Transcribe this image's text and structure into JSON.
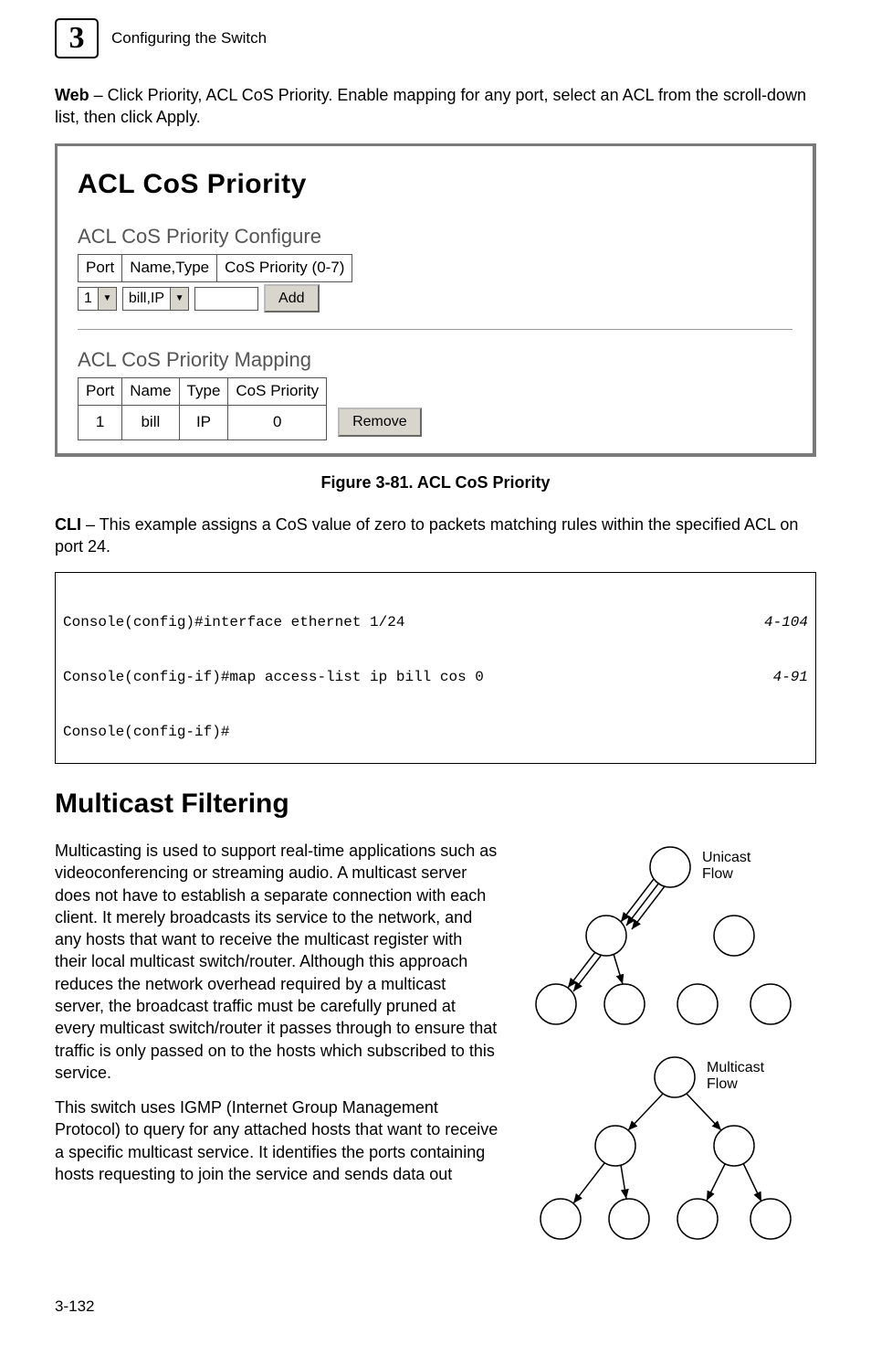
{
  "header": {
    "chapter_num": "3",
    "chapter_title": "Configuring the Switch"
  },
  "intro1": {
    "bold": "Web",
    "rest": " – Click Priority, ACL CoS Priority. Enable mapping for any port, select an ACL from the scroll-down list, then click Apply."
  },
  "screenshot": {
    "title": "ACL CoS Priority",
    "configure_heading": "ACL CoS Priority Configure",
    "cfg_headers": {
      "port": "Port",
      "name_type": "Name,Type",
      "cos": "CoS Priority (0-7)"
    },
    "cfg_row": {
      "port": "1",
      "name_type": "bill,IP",
      "cos": "",
      "add_btn": "Add"
    },
    "mapping_heading": "ACL CoS Priority Mapping",
    "map_headers": {
      "port": "Port",
      "name": "Name",
      "type": "Type",
      "cos": "CoS Priority"
    },
    "map_row": {
      "port": "1",
      "name": "bill",
      "type": "IP",
      "cos": "0",
      "remove_btn": "Remove"
    }
  },
  "figure_caption": "Figure 3-81.  ACL CoS Priority",
  "intro2": {
    "bold": "CLI",
    "rest": " – This example assigns a CoS value of zero to packets matching rules within the specified ACL on port 24."
  },
  "code": {
    "l1": "Console(config)#interface ethernet 1/24",
    "r1": "4-104",
    "l2": "Console(config-if)#map access-list ip bill cos 0",
    "r2": "4-91",
    "l3": "Console(config-if)#"
  },
  "section_heading": "Multicast Filtering",
  "para1": "Multicasting is used to support real-time applications such as videoconferencing or streaming audio. A multicast server does not have to establish a separate connection with each client. It merely broadcasts its service to the network, and any hosts that want to receive the multicast register with their local multicast switch/router. Although this approach reduces the network overhead required by a multicast server, the broadcast traffic must be carefully pruned at every multicast switch/router it passes through to ensure that traffic is only passed on to the hosts which subscribed to this service.",
  "para2": "This switch uses IGMP (Internet Group Management Protocol) to query for any attached hosts that want to receive a specific multicast service. It identifies the ports containing hosts requesting to join the service and sends data out",
  "diagram": {
    "unicast_l1": "Unicast",
    "unicast_l2": "Flow",
    "multicast_l1": "Multicast",
    "multicast_l2": "Flow"
  },
  "page_number": "3-132"
}
